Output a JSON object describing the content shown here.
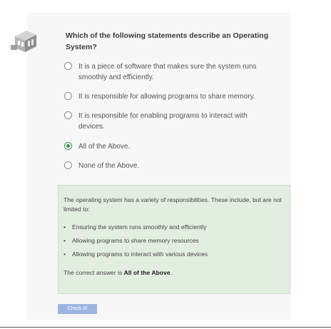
{
  "question": {
    "text": "Which of the following statements describe an Operating System?"
  },
  "options": [
    {
      "label": "It is a piece of software that makes sure the system runs smoothly and efficiently.",
      "selected": false
    },
    {
      "label": "It is responsible for allowing programs to share memory.",
      "selected": false
    },
    {
      "label": "It is responsible for enabling programs to interact with devices.",
      "selected": false
    },
    {
      "label": "All of the Above.",
      "selected": true
    },
    {
      "label": "None of the Above.",
      "selected": false
    }
  ],
  "feedback": {
    "intro": "The operating system has a variety of responsibilities. These include, but are not limited to:",
    "bullets": [
      "Ensuring the system runs smoothly and efficiently",
      "Allowing programs to share memory resources",
      "Allowing programs to interact with various devices"
    ],
    "answer_prefix": "The correct answer is ",
    "answer_value": "All of the Above",
    "answer_suffix": "."
  },
  "check_button": {
    "label": "Check It!"
  },
  "colors": {
    "accent_green": "#3d8f47",
    "feedback_bg": "#e2eee0",
    "button_bg": "#9db5e2",
    "card_bg": "#f7f7f7"
  },
  "icons": {
    "avatar": "building-icon"
  }
}
